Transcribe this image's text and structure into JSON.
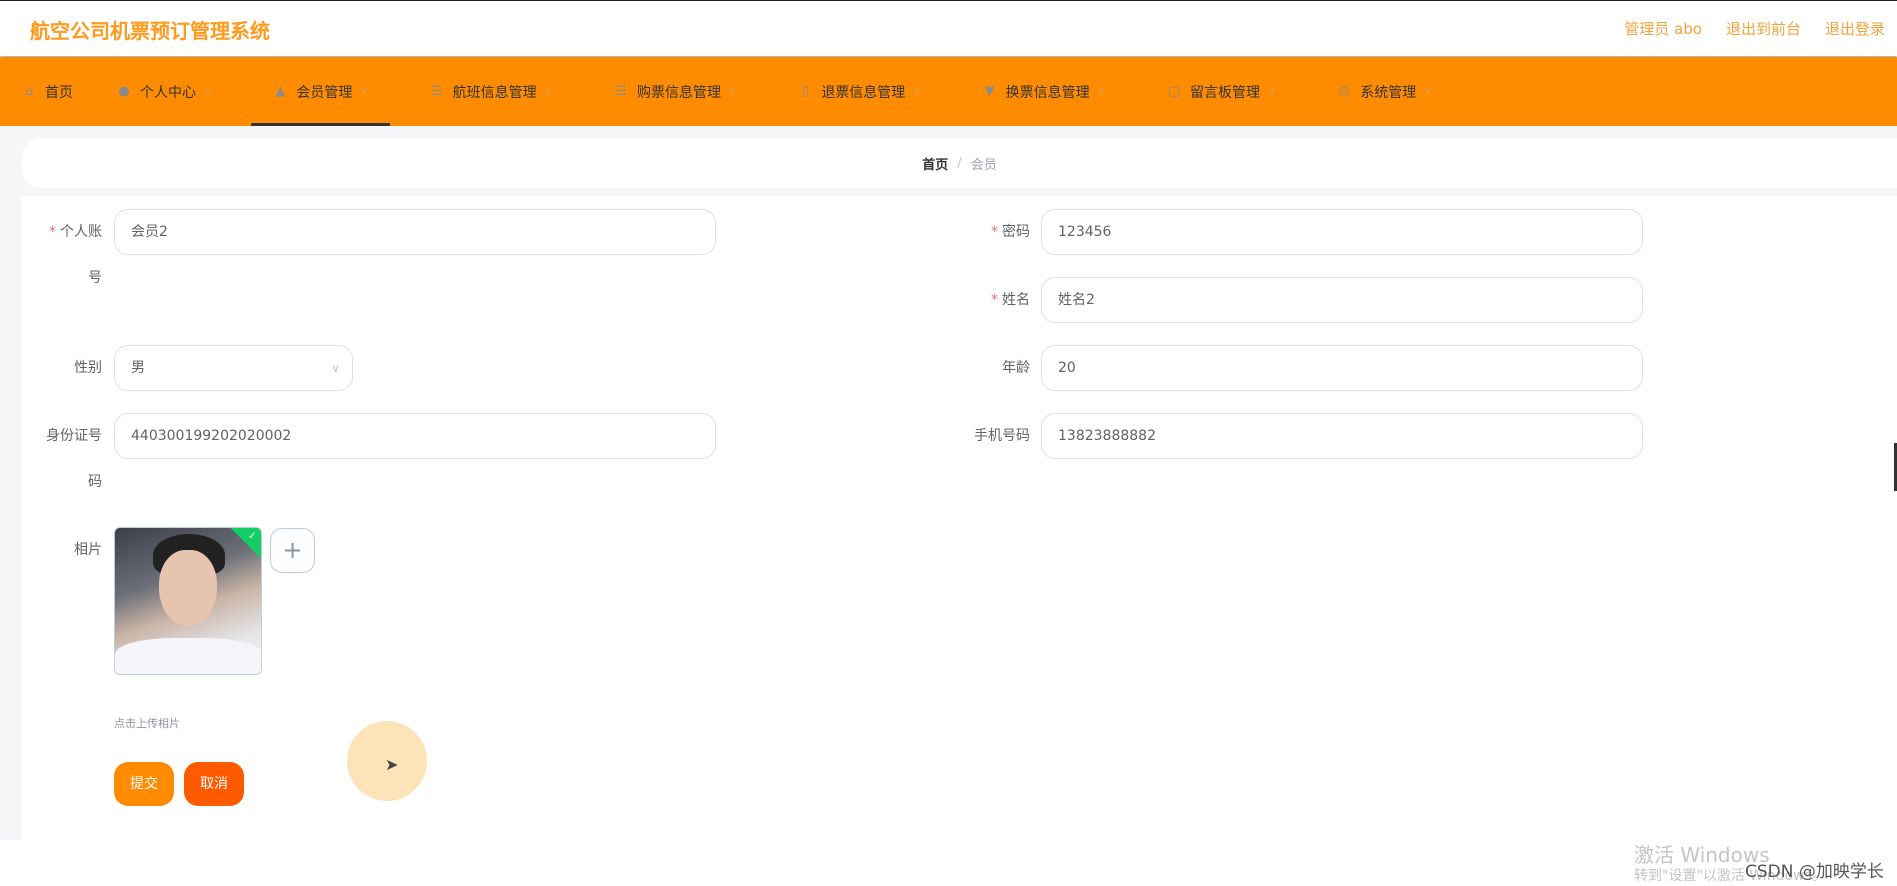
{
  "header": {
    "title": "航空公司机票预订管理系统",
    "user": "管理员 abo",
    "to_front": "退出到前台",
    "logout": "退出登录"
  },
  "nav": [
    {
      "label": "首页",
      "icon": "home-icon",
      "chevron": false
    },
    {
      "label": "个人中心",
      "icon": "user-icon",
      "chevron": true
    },
    {
      "label": "会员管理",
      "icon": "member-icon",
      "chevron": true,
      "active": true
    },
    {
      "label": "航班信息管理",
      "icon": "list-icon",
      "chevron": true
    },
    {
      "label": "购票信息管理",
      "icon": "list-icon",
      "chevron": true
    },
    {
      "label": "退票信息管理",
      "icon": "document-icon",
      "chevron": true
    },
    {
      "label": "换票信息管理",
      "icon": "pin-icon",
      "chevron": true
    },
    {
      "label": "留言板管理",
      "icon": "message-icon",
      "chevron": true
    },
    {
      "label": "系统管理",
      "icon": "settings-icon",
      "chevron": true
    }
  ],
  "breadcrumb": {
    "home": "首页",
    "sep": "/",
    "current": "会员"
  },
  "form": {
    "account": {
      "label1": "个人账",
      "label2": "号",
      "value": "会员2"
    },
    "password": {
      "label": "密码",
      "value": "123456"
    },
    "name": {
      "label": "姓名",
      "value": "姓名2"
    },
    "gender": {
      "label": "性别",
      "value": "男"
    },
    "age": {
      "label": "年龄",
      "value": "20"
    },
    "idcard": {
      "label1": "身份证号",
      "label2": "码",
      "value": "440300199202020002"
    },
    "phone": {
      "label": "手机号码",
      "value": "13823888882"
    },
    "photo": {
      "label": "相片",
      "hint": "点击上传相片"
    },
    "submit": "提交",
    "cancel": "取消",
    "submit_color": "#ff8c00",
    "cancel_color": "#ff5a00"
  },
  "watermark": {
    "line1": "激活 Windows",
    "line2": "转到\"设置\"以激活 Windows。",
    "csdn": "CSDN @加映学长"
  }
}
